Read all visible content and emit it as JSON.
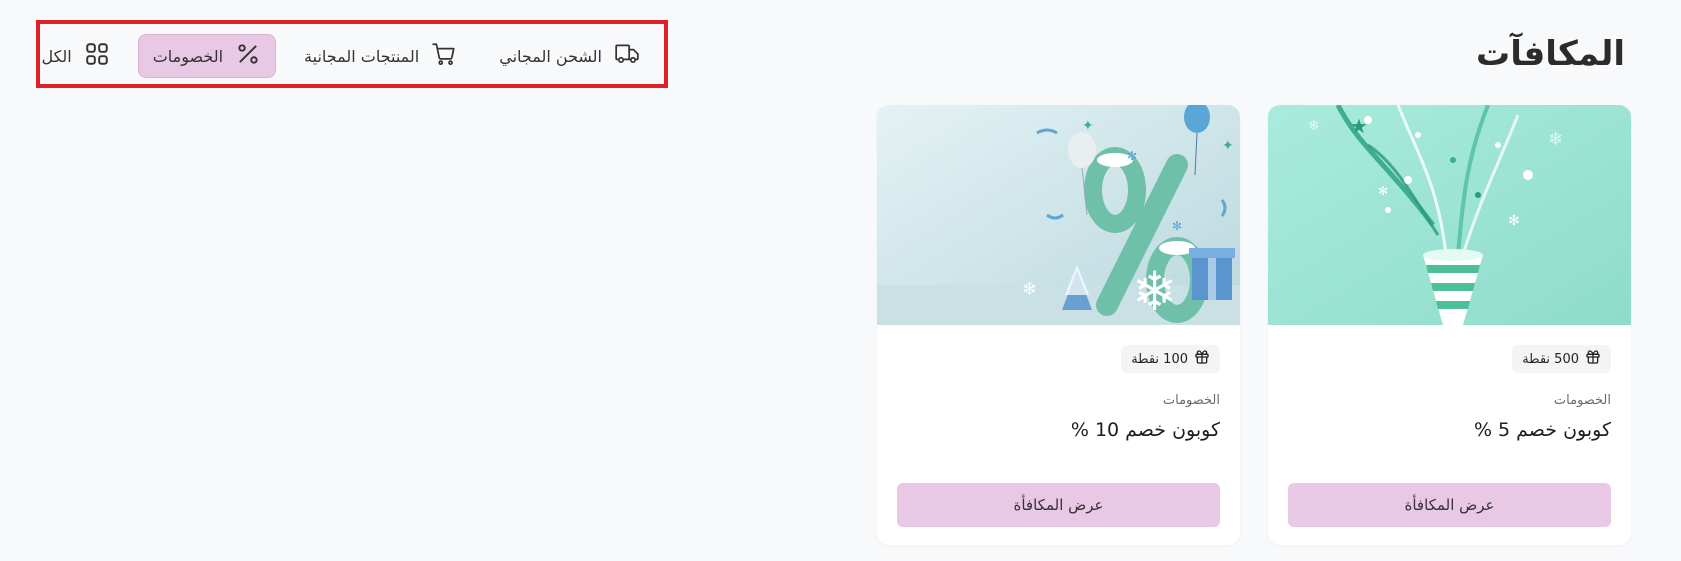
{
  "page": {
    "title": "المكافآت"
  },
  "filters": {
    "tabs": [
      {
        "label": "الكل",
        "icon": "grid-icon",
        "active": false
      },
      {
        "label": "الخصومات",
        "icon": "percent-icon",
        "active": true
      },
      {
        "label": "المنتجات المجانية",
        "icon": "cart-icon",
        "active": false
      },
      {
        "label": "الشحن المجاني",
        "icon": "truck-icon",
        "active": false
      }
    ]
  },
  "rewards": [
    {
      "points": "500 نقطة",
      "category": "الخصومات",
      "title": "كوبون خصم 5 %",
      "button": "عرض المكافأة",
      "image": "party-popper-image"
    },
    {
      "points": "100 نقطة",
      "category": "الخصومات",
      "title": "كوبون خصم 10 %",
      "button": "عرض المكافأة",
      "image": "percent-balloons-image"
    }
  ],
  "colors": {
    "accent": "#e8c8e4",
    "highlight_border": "#e01f26",
    "background": "#f8f9fb",
    "card_mint": "#a8e6d8"
  }
}
